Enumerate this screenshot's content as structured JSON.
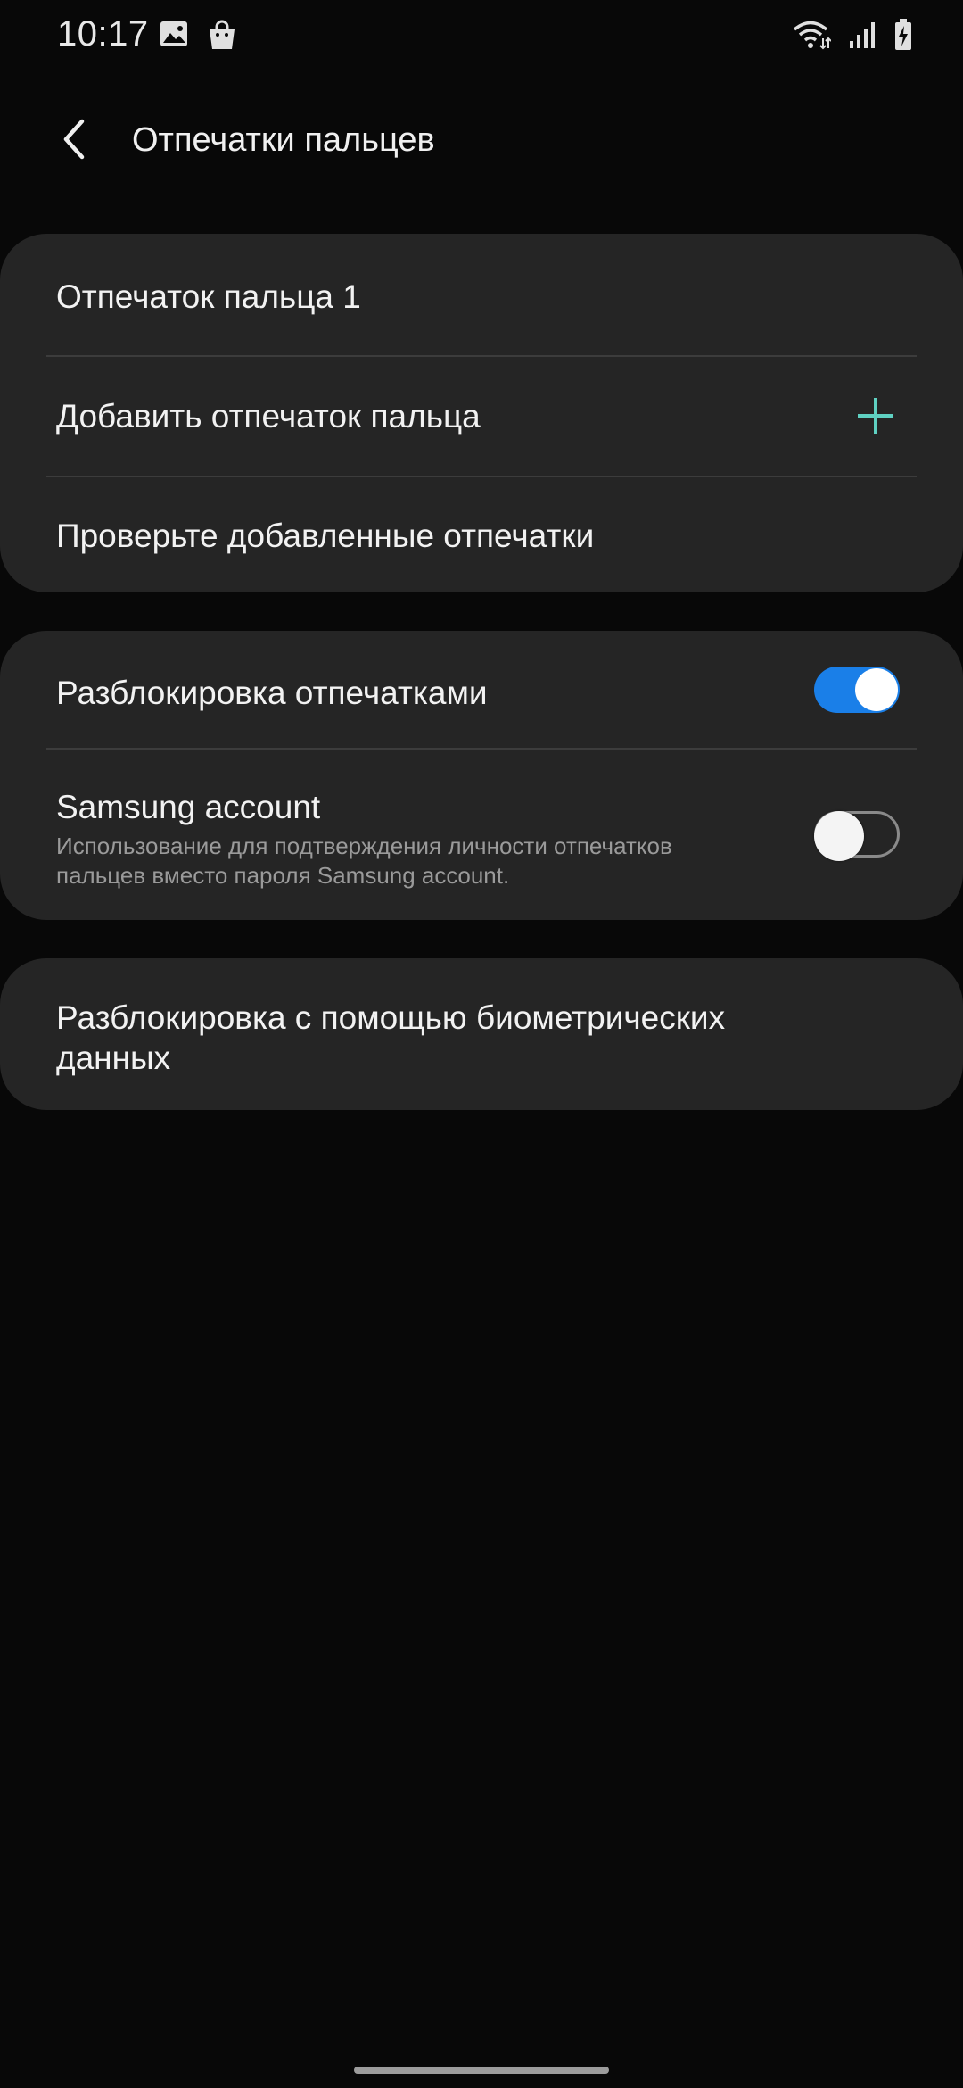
{
  "status_bar": {
    "time": "10:17",
    "icons_left": [
      "gallery-icon",
      "shopping-bag-icon"
    ],
    "icons_right": [
      "wifi-icon",
      "signal-icon",
      "battery-charging-icon"
    ]
  },
  "header": {
    "title": "Отпечатки пальцев",
    "back_icon": "chevron-left-icon"
  },
  "group1": {
    "fingerprint1": "Отпечаток пальца 1",
    "add_fingerprint": "Добавить отпечаток пальца",
    "add_icon": "plus-icon",
    "check_fingerprints": "Проверьте добавленные отпечатки"
  },
  "group2": {
    "unlock_label": "Разблокировка отпечатками",
    "unlock_enabled": true,
    "samsung_label": "Samsung account",
    "samsung_desc_line1": "Использование для подтверждения личности отпечатков",
    "samsung_desc_line2": "пальцев вместо пароля Samsung account.",
    "samsung_enabled": false
  },
  "group3": {
    "biometric_line1": "Разблокировка с помощью биометрических",
    "biometric_line2": "данных"
  },
  "colors": {
    "background": "#080808",
    "card": "#252525",
    "toggle_on": "#1a7fe8",
    "plus_accent": "#5fd1c2"
  }
}
